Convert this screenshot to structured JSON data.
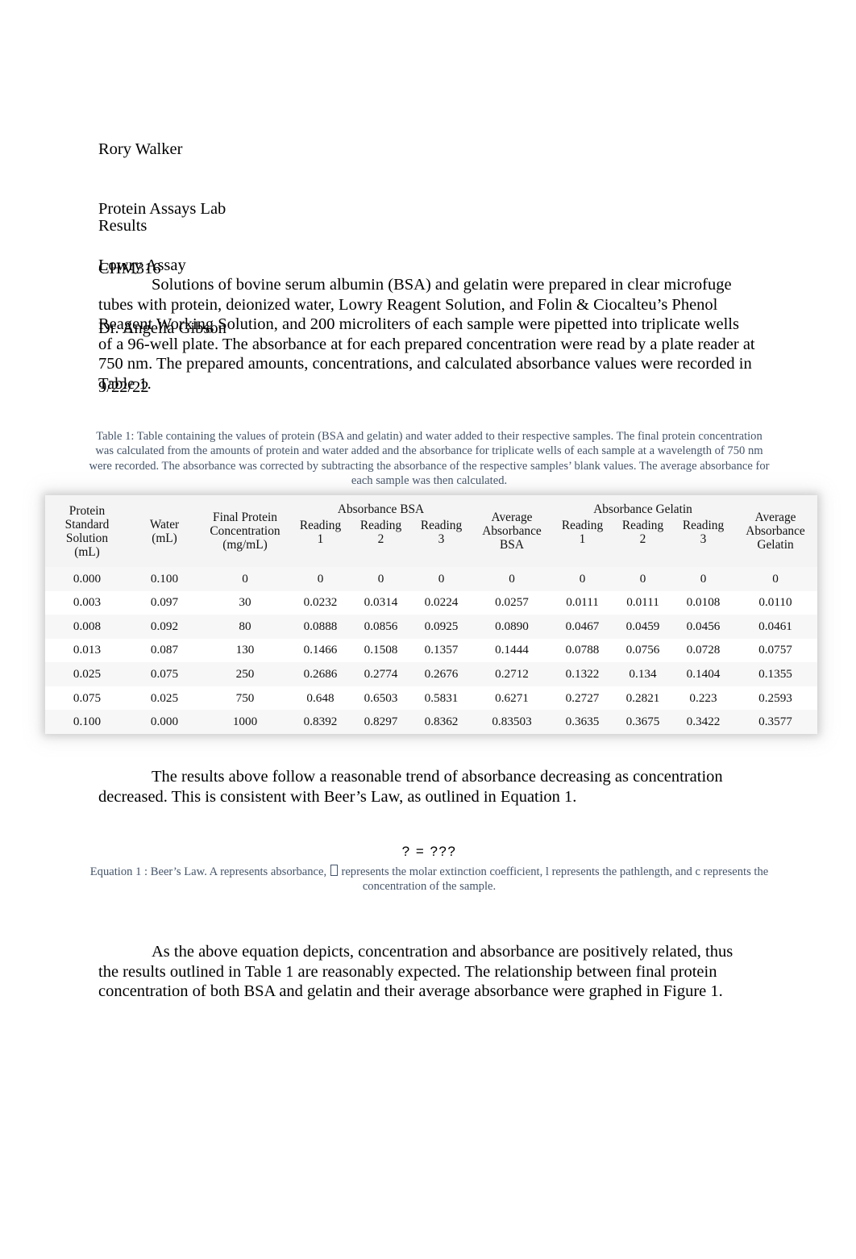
{
  "header": {
    "author": "Rory Walker",
    "lab_title": "Protein Assays Lab",
    "course": "CHM316",
    "instructor": "Dr. Angelia Gibson",
    "date": "9/22/22"
  },
  "sections": {
    "results_heading": "Results",
    "lowry_heading": "Lowry Assay"
  },
  "paragraphs": {
    "lowry": "Solutions of bovine serum albumin (BSA) and gelatin were prepared  in clear microfuge tubes with protein, deionized water, Lowry Reagent Solution, and Folin & Ciocalteu’s Phenol Reagent Working Solution, and 200 microliters of each sample were pipetted into triplicate wells of a 96-well plate. The absorbance at for each prepared concentration were read by a plate reader at 750 nm. The prepared amounts, concentrations, and calculated absorbance values were recorded in Table 1.",
    "trend": "The results above follow a reasonable trend of absorbance decreasing as concentration decreased. This is consistent with Beer’s Law, as outlined in Equation 1.",
    "figure": "As the above equation depicts, concentration and absorbance are positively related, thus the results outlined in Table 1 are reasonably expected. The relationship between final protein concentration of both BSA and gelatin and their average absorbance were graphed in Figure 1."
  },
  "table_caption": "Table 1: Table containing the values of protein (BSA and gelatin) and water added to their respective samples. The final protein concentration was calculated from the amounts of protein and water added and the absorbance for triplicate wells of each sample at a wavelength of 750 nm were recorded. The absorbance was corrected by  subtracting the absorbance of the respective samples’ blank values. The average absorbance for each sample was then calculated.",
  "equation": {
    "formula": "? = ???",
    "caption_before": "Equation 1 : Beer’s Law. A represents absorbance, ",
    "caption_after": " represents the molar extinction coefficient, l represents the pathlength, and c represents the concentration of the sample."
  },
  "table": {
    "group_headers": {
      "absorbance_bsa": "Absorbance BSA",
      "absorbance_gelatin": "Absorbance Gelatin"
    },
    "columns": [
      {
        "lines": [
          "Protein",
          "Standard",
          "Solution",
          "(mL)"
        ]
      },
      {
        "lines": [
          "Water",
          "(mL)"
        ]
      },
      {
        "lines": [
          "Final Protein",
          "Concentration",
          "(mg/mL)"
        ]
      },
      {
        "lines": [
          "Reading",
          "1"
        ]
      },
      {
        "lines": [
          "Reading",
          "2"
        ]
      },
      {
        "lines": [
          "Reading",
          "3"
        ]
      },
      {
        "lines": [
          "Average",
          "Absorbance",
          "BSA"
        ]
      },
      {
        "lines": [
          "Reading",
          "1"
        ]
      },
      {
        "lines": [
          "Reading",
          "2"
        ]
      },
      {
        "lines": [
          "Reading",
          "3"
        ]
      },
      {
        "lines": [
          "Average",
          "Absorbance",
          "Gelatin"
        ]
      }
    ],
    "rows": [
      [
        "0.000",
        "0.100",
        "0",
        "0",
        "0",
        "0",
        "0",
        "0",
        "0",
        "0",
        "0"
      ],
      [
        "0.003",
        "0.097",
        "30",
        "0.0232",
        "0.0314",
        "0.0224",
        "0.0257",
        "0.0111",
        "0.0111",
        "0.0108",
        "0.0110"
      ],
      [
        "0.008",
        "0.092",
        "80",
        "0.0888",
        "0.0856",
        "0.0925",
        "0.0890",
        "0.0467",
        "0.0459",
        "0.0456",
        "0.0461"
      ],
      [
        "0.013",
        "0.087",
        "130",
        "0.1466",
        "0.1508",
        "0.1357",
        "0.1444",
        "0.0788",
        "0.0756",
        "0.0728",
        "0.0757"
      ],
      [
        "0.025",
        "0.075",
        "250",
        "0.2686",
        "0.2774",
        "0.2676",
        "0.2712",
        "0.1322",
        "0.134",
        "0.1404",
        "0.1355"
      ],
      [
        "0.075",
        "0.025",
        "750",
        "0.648",
        "0.6503",
        "0.5831",
        "0.6271",
        "0.2727",
        "0.2821",
        "0.223",
        "0.2593"
      ],
      [
        "0.100",
        "0.000",
        "1000",
        "0.8392",
        "0.8297",
        "0.8362",
        "0.83503",
        "0.3635",
        "0.3675",
        "0.3422",
        "0.3577"
      ]
    ]
  },
  "colors": {
    "caption": "#44546A",
    "text": "#000000",
    "page_background": "#FFFFFF"
  }
}
